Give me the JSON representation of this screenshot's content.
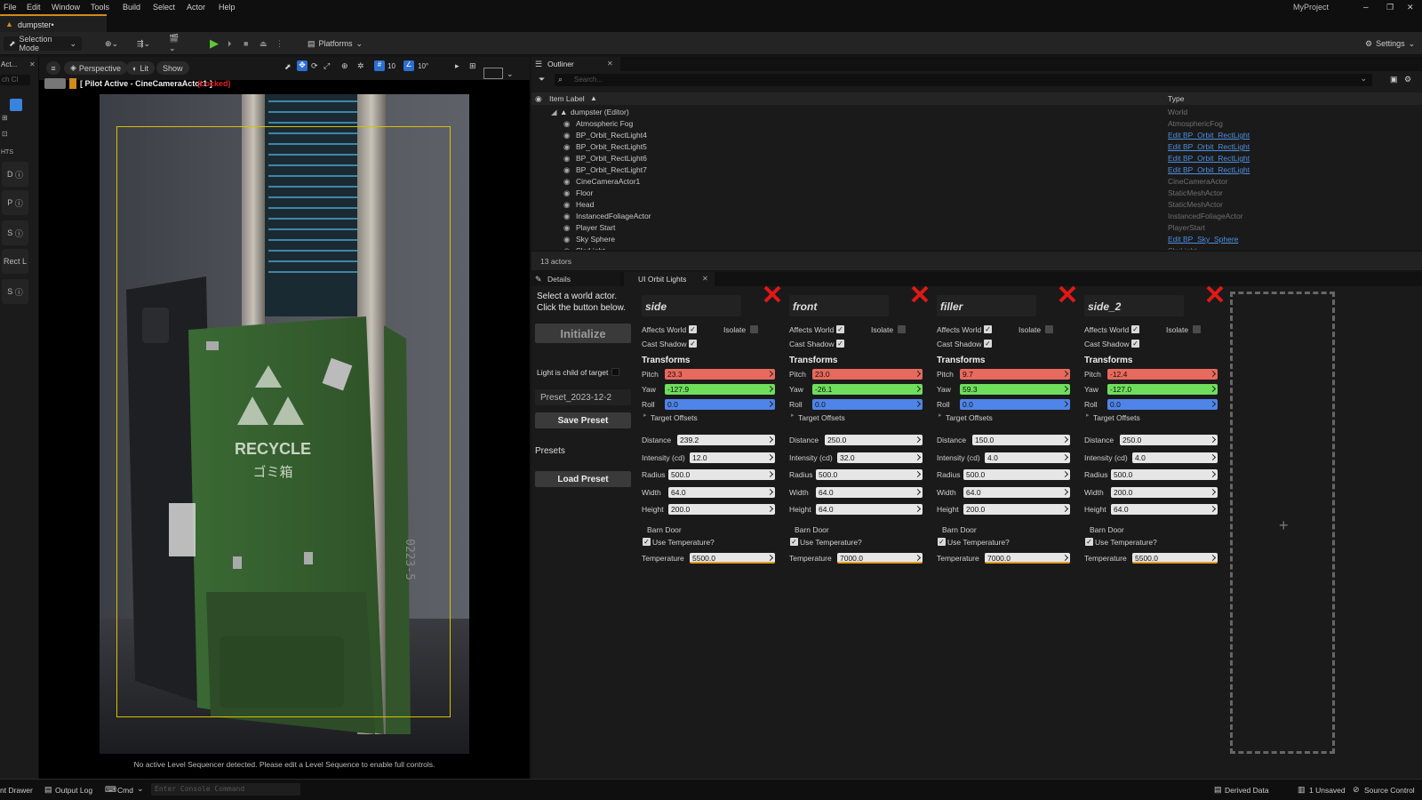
{
  "menu": [
    "File",
    "Edit",
    "Window",
    "Tools",
    "Build",
    "Select",
    "Actor",
    "Help"
  ],
  "project_name": "MyProject",
  "doc_tab": "dumpster•",
  "toolbar": {
    "selection_mode": "Selection Mode",
    "platforms": "Platforms",
    "settings": "Settings"
  },
  "left_strip": {
    "top": "Act...",
    "search": "ch Cl",
    "heading": "HTS",
    "items": [
      "D",
      "P",
      "S",
      "Rect L",
      "S"
    ]
  },
  "viewport": {
    "perspective": "Perspective",
    "lit": "Lit",
    "show": "Show",
    "grid_size": "10",
    "angle": "10°",
    "pilot_label": "[ Pilot Active - CineCameraActor1 ]",
    "locked": "(Locked)",
    "message": "No active Level Sequencer detected. Please edit a Level Sequence to enable full controls.",
    "sign_main": "RECYCLE",
    "sign_sub": "ゴミ箱",
    "serial": "0223-5"
  },
  "outliner": {
    "title": "Outliner",
    "search_placeholder": "Search...",
    "col_label": "Item Label",
    "col_type": "Type",
    "root": {
      "label": "dumpster (Editor)",
      "type": "World"
    },
    "rows": [
      {
        "label": "Atmospheric Fog",
        "type": "AtmosphericFog",
        "link": false
      },
      {
        "label": "BP_Orbit_RectLight4",
        "type": "Edit BP_Orbit_RectLight",
        "link": true
      },
      {
        "label": "BP_Orbit_RectLight5",
        "type": "Edit BP_Orbit_RectLight",
        "link": true
      },
      {
        "label": "BP_Orbit_RectLight6",
        "type": "Edit BP_Orbit_RectLight",
        "link": true
      },
      {
        "label": "BP_Orbit_RectLight7",
        "type": "Edit BP_Orbit_RectLight",
        "link": true
      },
      {
        "label": "CineCameraActor1",
        "type": "CineCameraActor",
        "link": false
      },
      {
        "label": "Floor",
        "type": "StaticMeshActor",
        "link": false
      },
      {
        "label": "Head",
        "type": "StaticMeshActor",
        "link": false
      },
      {
        "label": "InstancedFoliageActor",
        "type": "InstancedFoliageActor",
        "link": false
      },
      {
        "label": "Player Start",
        "type": "PlayerStart",
        "link": false
      },
      {
        "label": "Sky Sphere",
        "type": "Edit BP_Sky_Sphere",
        "link": true
      },
      {
        "label": "SkyLight",
        "type": "SkyLight",
        "link": false
      }
    ],
    "actor_count": "13 actors"
  },
  "details": {
    "tab_details": "Details",
    "tab_orbit": "UI Orbit Lights",
    "instructions_1": "Select a world actor.",
    "instructions_2": "Click the button below.",
    "initialize": "Initialize",
    "child_of_target": "Light is child of target",
    "preset_name": "Preset_2023-12-2",
    "save_preset": "Save Preset",
    "presets_label": "Presets",
    "load_preset": "Load Preset"
  },
  "labels": {
    "affects_world": "Affects World",
    "isolate": "Isolate",
    "cast_shadow": "Cast Shadow",
    "transforms": "Transforms",
    "pitch": "Pitch",
    "yaw": "Yaw",
    "roll": "Roll",
    "target_offsets": "Target Offsets",
    "distance": "Distance",
    "intensity": "Intensity (cd)",
    "radius": "Radius",
    "width": "Width",
    "height": "Height",
    "barn_door": "Barn Door",
    "use_temperature": "Use Temperature?",
    "temperature": "Temperature"
  },
  "lights": [
    {
      "name": "side",
      "affects_world": true,
      "isolate": false,
      "cast_shadow": true,
      "pitch": "23.3",
      "yaw": "-127.9",
      "roll": "0.0",
      "distance": "239.2",
      "intensity": "12.0",
      "radius": "500.0",
      "width": "64.0",
      "height": "200.0",
      "use_temperature": true,
      "temperature": "5500.0"
    },
    {
      "name": "front",
      "affects_world": true,
      "isolate": false,
      "cast_shadow": true,
      "pitch": "23.0",
      "yaw": "-26.1",
      "roll": "0.0",
      "distance": "250.0",
      "intensity": "32.0",
      "radius": "500.0",
      "width": "64.0",
      "height": "64.0",
      "use_temperature": true,
      "temperature": "7000.0"
    },
    {
      "name": "filler",
      "affects_world": true,
      "isolate": false,
      "cast_shadow": true,
      "pitch": "9.7",
      "yaw": "59.3",
      "roll": "0.0",
      "distance": "150.0",
      "intensity": "4.0",
      "radius": "500.0",
      "width": "64.0",
      "height": "200.0",
      "use_temperature": true,
      "temperature": "7000.0"
    },
    {
      "name": "side_2",
      "affects_world": true,
      "isolate": false,
      "cast_shadow": true,
      "pitch": "-12.4",
      "yaw": "-127.0",
      "roll": "0.0",
      "distance": "250.0",
      "intensity": "4.0",
      "radius": "500.0",
      "width": "200.0",
      "height": "64.0",
      "use_temperature": true,
      "temperature": "5500.0"
    }
  ],
  "colors": {
    "pitch": "#e8695d",
    "yaw": "#6ede5b",
    "roll": "#4f84e8",
    "accent": "#d18a1a",
    "delete": "#e01818",
    "locked": "#e02020"
  },
  "statusbar": {
    "content_drawer": "nt Drawer",
    "output_log": "Output Log",
    "cmd": "Cmd",
    "console_placeholder": "Enter Console Command",
    "derived_data": "Derived Data",
    "unsaved": "1 Unsaved",
    "source_control": "Source Control"
  }
}
